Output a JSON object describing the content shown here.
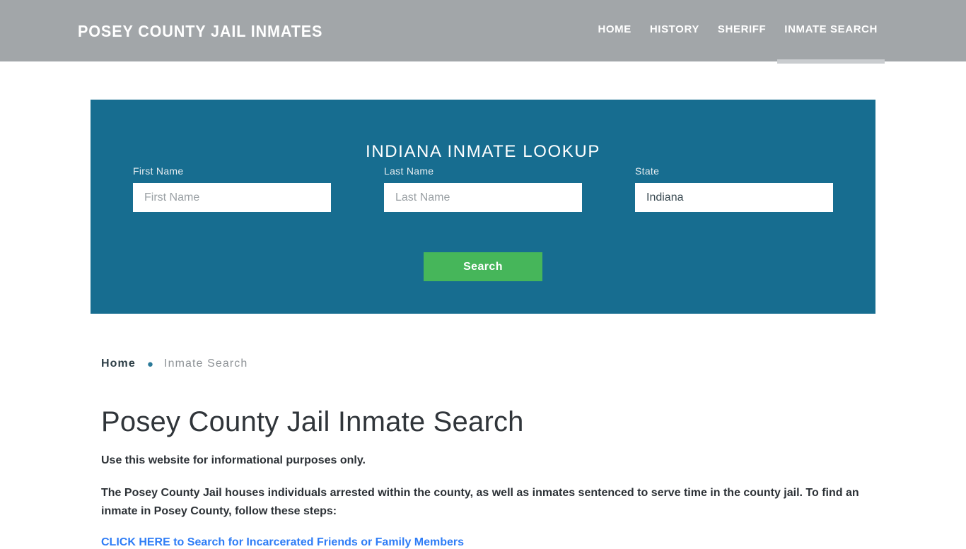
{
  "header": {
    "brand": "POSEY COUNTY JAIL INMATES",
    "background_color": "#a2a6a9",
    "nav": [
      {
        "label": "HOME",
        "active": false
      },
      {
        "label": "HISTORY",
        "active": false
      },
      {
        "label": "SHERIFF",
        "active": false
      },
      {
        "label": "INMATE SEARCH",
        "active": true
      }
    ]
  },
  "hero": {
    "title": "INDIANA INMATE LOOKUP",
    "background_color": "#176d90",
    "fields": {
      "first_name": {
        "label": "First Name",
        "placeholder": "First Name",
        "value": ""
      },
      "last_name": {
        "label": "Last Name",
        "placeholder": "Last Name",
        "value": ""
      },
      "state": {
        "label": "State",
        "placeholder": "State",
        "value": "Indiana"
      }
    },
    "search_button": {
      "label": "Search",
      "color": "#46b65a"
    }
  },
  "breadcrumb": {
    "home": "Home",
    "separator": "●",
    "current": "Inmate Search",
    "separator_color": "#2b7a99"
  },
  "main": {
    "page_title": "Posey County Jail Inmate Search",
    "lead": "Use this website for informational purposes only.",
    "paragraph": "The Posey County Jail houses individuals arrested within the county, as well as inmates sentenced to serve time in the county jail. To find an inmate in Posey County, follow these steps:",
    "cta_link": "CLICK HERE to Search for Incarcerated Friends or Family Members",
    "link_color": "#2f7df6"
  }
}
